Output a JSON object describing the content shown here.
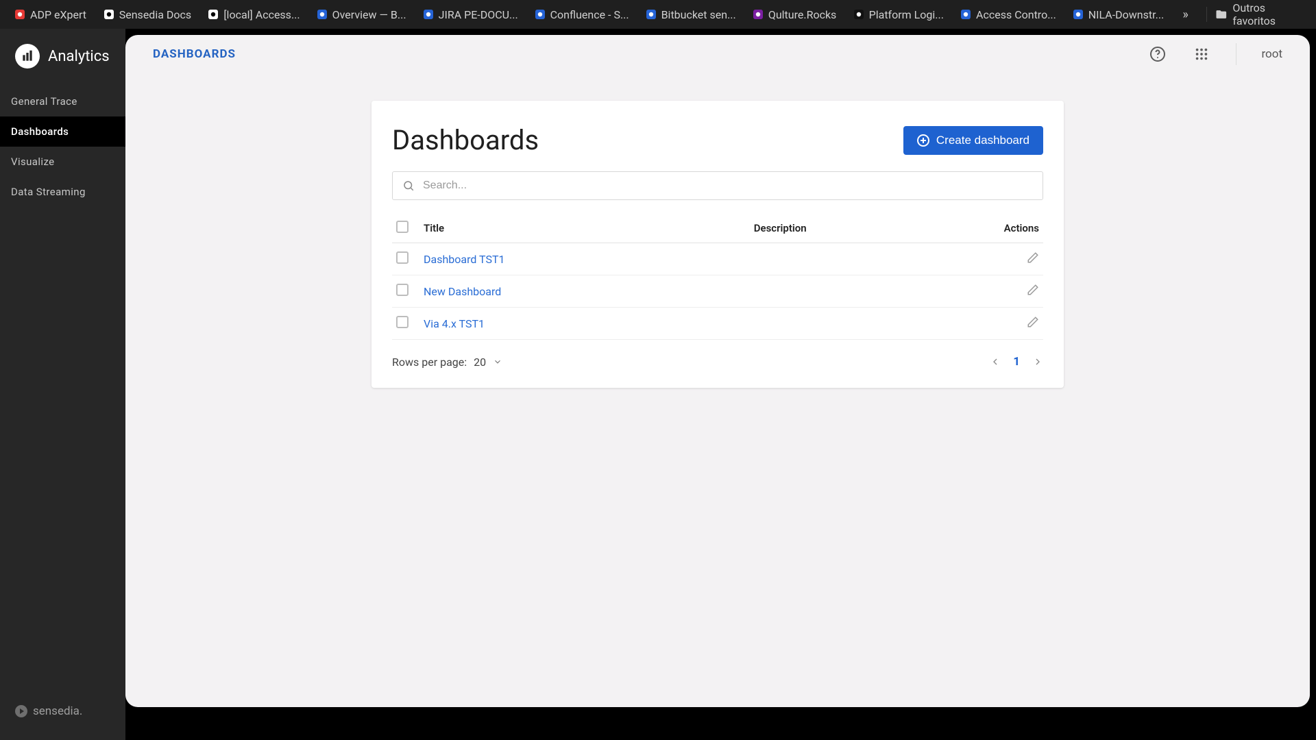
{
  "browser": {
    "tabs": [
      {
        "label": "ADP eXpert",
        "fav_bg": "#e53935",
        "fav_fg": "#fff"
      },
      {
        "label": "Sensedia Docs",
        "fav_bg": "#ffffff",
        "fav_fg": "#000"
      },
      {
        "label": "[local] Access...",
        "fav_bg": "#ffffff",
        "fav_fg": "#000"
      },
      {
        "label": "Overview — B...",
        "fav_bg": "#2563d6",
        "fav_fg": "#fff"
      },
      {
        "label": "JIRA PE-DOCU...",
        "fav_bg": "#2563d6",
        "fav_fg": "#fff"
      },
      {
        "label": "Confluence - S...",
        "fav_bg": "#2563d6",
        "fav_fg": "#fff"
      },
      {
        "label": "Bitbucket sen...",
        "fav_bg": "#2563d6",
        "fav_fg": "#fff"
      },
      {
        "label": "Qulture.Rocks",
        "fav_bg": "#7b1fa2",
        "fav_fg": "#fff"
      },
      {
        "label": "Platform Logi...",
        "fav_bg": "#111",
        "fav_fg": "#fff"
      },
      {
        "label": "Access Contro...",
        "fav_bg": "#2563d6",
        "fav_fg": "#fff"
      },
      {
        "label": "NILA-Downstr...",
        "fav_bg": "#2563d6",
        "fav_fg": "#fff"
      }
    ],
    "overflow": "»",
    "bookmarks_folder": "Outros favoritos"
  },
  "sidebar": {
    "brand": "Analytics",
    "items": [
      {
        "label": "General Trace",
        "active": false
      },
      {
        "label": "Dashboards",
        "active": true
      },
      {
        "label": "Visualize",
        "active": false
      },
      {
        "label": "Data Streaming",
        "active": false
      }
    ],
    "footer": "sensedia."
  },
  "topbar": {
    "breadcrumb": "DASHBOARDS",
    "user": "root"
  },
  "page": {
    "title": "Dashboards",
    "create_label": "Create dashboard",
    "search_placeholder": "Search...",
    "columns": {
      "title": "Title",
      "description": "Description",
      "actions": "Actions"
    },
    "rows": [
      {
        "title": "Dashboard TST1",
        "description": ""
      },
      {
        "title": "New Dashboard",
        "description": ""
      },
      {
        "title": "Via 4.x TST1",
        "description": ""
      }
    ],
    "rows_per_page_label": "Rows per page:",
    "rows_per_page_value": "20",
    "current_page": "1"
  }
}
